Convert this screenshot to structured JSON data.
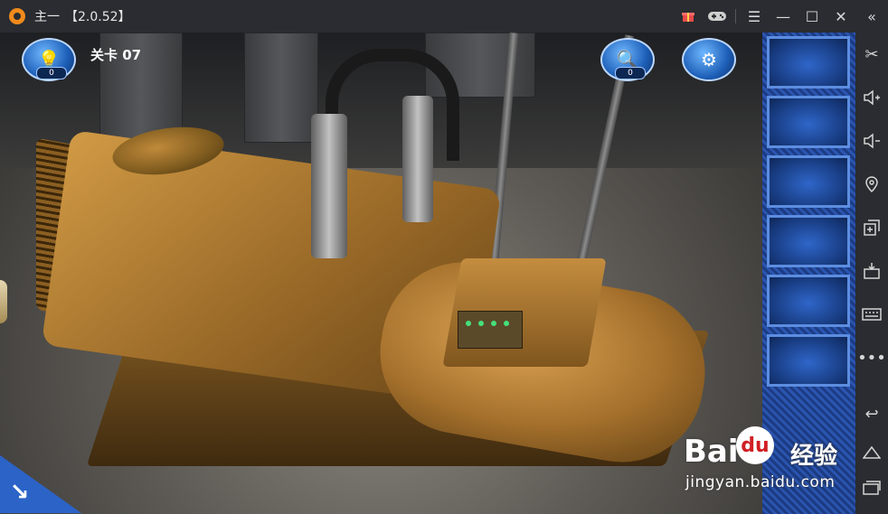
{
  "titlebar": {
    "app_name": "主一",
    "version": "【2.0.52】",
    "icons": [
      "gift-icon",
      "gamepad-icon",
      "menu-icon",
      "minimize-icon",
      "maximize-icon",
      "close-icon",
      "collapse-icon"
    ]
  },
  "hud": {
    "hint_count": "0",
    "level_label": "关卡 07",
    "search_count": "0",
    "settings_icon": "gear-icon"
  },
  "inventory": {
    "slots": 6,
    "colors": {
      "frame": "#5c8de0",
      "slot": "#1f4fa8"
    }
  },
  "toolstrip": {
    "tools": [
      "scissors-icon",
      "volume-up-icon",
      "volume-down-icon",
      "location-icon",
      "multi-window-icon",
      "apk-install-icon",
      "keyboard-icon",
      "more-icon",
      "back-icon",
      "home-icon",
      "recent-apps-icon"
    ]
  },
  "watermark": {
    "brand_a": "Bai",
    "brand_paw": "du",
    "brand_cn": "经验",
    "url": "jingyan.baidu.com"
  },
  "colors": {
    "accent": "#2b63c7",
    "titlebar": "#2a2c31",
    "generator": "#b7802f"
  }
}
